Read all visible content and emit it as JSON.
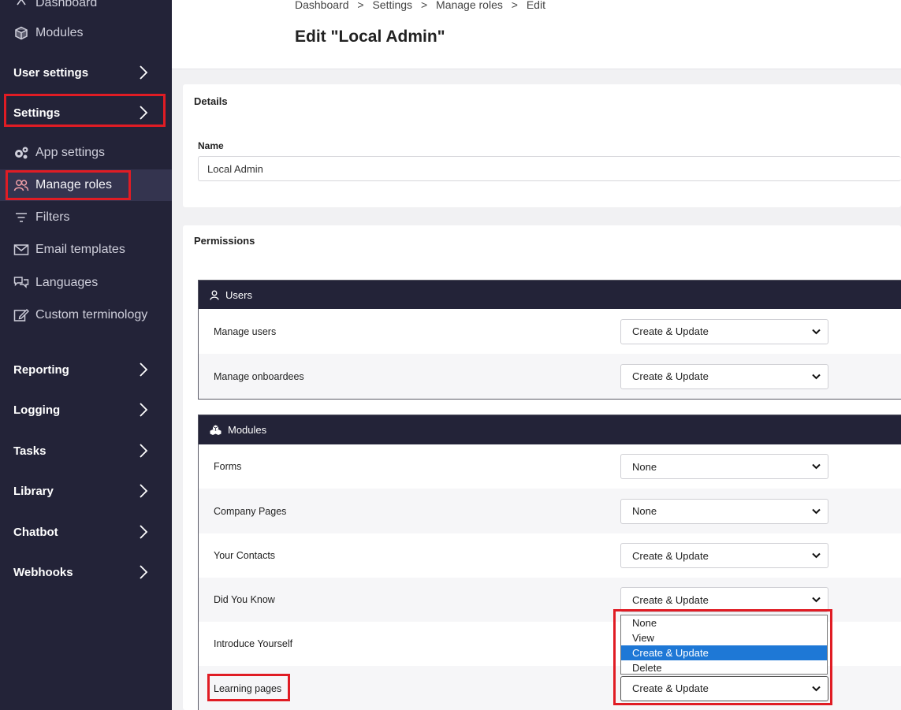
{
  "sidebar": {
    "dashboard": "Dashboard",
    "modules": "Modules",
    "user_settings": "User settings",
    "settings": "Settings",
    "app_settings": "App settings",
    "manage_roles": "Manage roles",
    "filters": "Filters",
    "email_templates": "Email templates",
    "languages": "Languages",
    "custom_terminology": "Custom terminology",
    "reporting": "Reporting",
    "logging": "Logging",
    "tasks": "Tasks",
    "library": "Library",
    "chatbot": "Chatbot",
    "webhooks": "Webhooks"
  },
  "breadcrumb": {
    "items": [
      "Dashboard",
      "Settings",
      "Manage roles",
      "Edit"
    ],
    "separator": ">"
  },
  "page_title": "Edit \"Local Admin\"",
  "details": {
    "title": "Details",
    "name_label": "Name",
    "name_value": "Local Admin"
  },
  "permissions": {
    "title": "Permissions",
    "users_group": {
      "title": "Users",
      "rows": [
        {
          "label": "Manage users",
          "value": "Create & Update"
        },
        {
          "label": "Manage onboardees",
          "value": "Create & Update"
        }
      ]
    },
    "modules_group": {
      "title": "Modules",
      "rows": [
        {
          "label": "Forms",
          "value": "None"
        },
        {
          "label": "Company Pages",
          "value": "None"
        },
        {
          "label": "Your Contacts",
          "value": "Create & Update"
        },
        {
          "label": "Did You Know",
          "value": "Create & Update"
        },
        {
          "label": "Introduce Yourself",
          "value": ""
        },
        {
          "label": "Learning pages",
          "value": "Create & Update"
        }
      ]
    }
  },
  "dropdown_open": {
    "options": [
      "None",
      "View",
      "Create & Update",
      "Delete"
    ],
    "selected": "Create & Update"
  },
  "colors": {
    "sidebar_bg": "#232338",
    "highlight_red": "#e01c24",
    "selected_option": "#1e78d6"
  }
}
